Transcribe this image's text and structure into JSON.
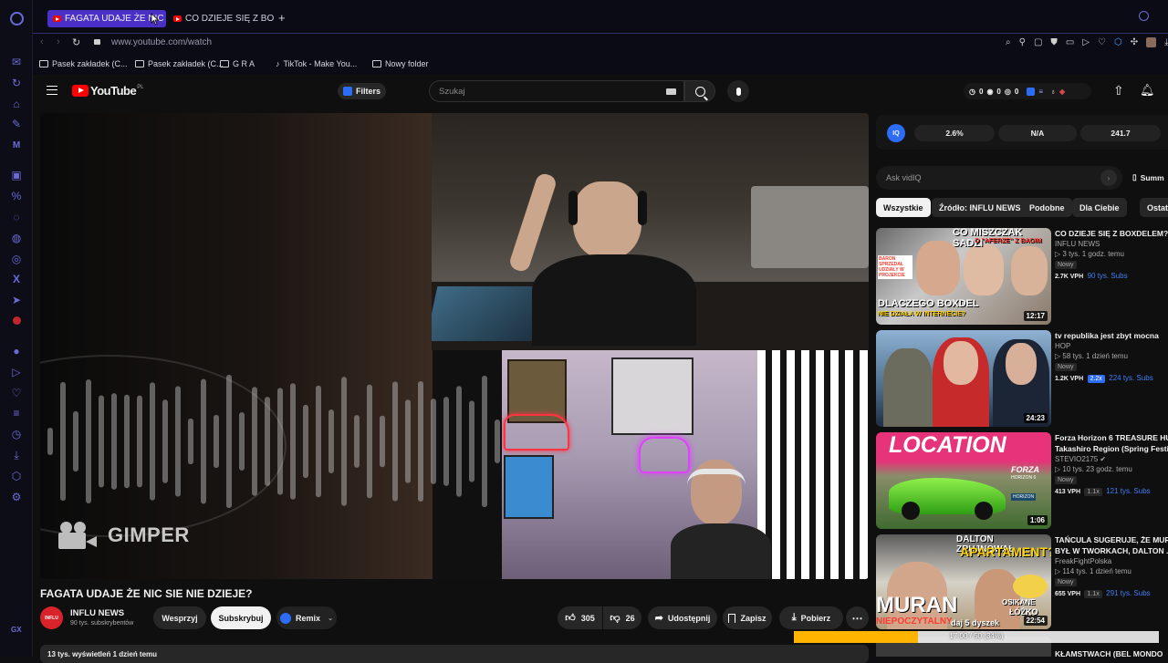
{
  "tabs": [
    {
      "label": "FAGATA UDAJE ŻE NIC"
    },
    {
      "label": "CO DZIEJE SIĘ Z BOXDELE"
    }
  ],
  "address": {
    "url": "www.youtube.com/watch"
  },
  "bookmarks": [
    "Pasek zakładek (C...",
    "Pasek zakładek (C...",
    "G R A",
    "TikTok - Make You...",
    "Nowy folder"
  ],
  "header": {
    "logo_text": "YouTube",
    "logo_region": "PL",
    "filters_label": "Filters",
    "search_placeholder": "Szukaj",
    "stats": [
      "0",
      "0",
      "0"
    ]
  },
  "player": {
    "watermark": "GIMPER"
  },
  "video": {
    "title": "FAGATA UDAJE ŻE NIC SIE NIE DZIEJE?",
    "channel": "INFLU NEWS",
    "subscribers": "90 tys. subskrybentów",
    "avatar_text": "INFLU",
    "support_label": "Wesprzyj",
    "subscribe_label": "Subskrybuj",
    "remix_label": "Remix",
    "likes": "305",
    "dislikes": "26",
    "share_label": "Udostępnij",
    "save_label": "Zapisz",
    "download_label": "Pobierz",
    "views_line": "13 tys. wyświetleń  1 dzień temu"
  },
  "vidiq": {
    "badge": "IQ",
    "stats": [
      "2.6%",
      "N/A",
      "241.7"
    ],
    "ask_placeholder": "Ask vidIQ",
    "summary_label": "Summ"
  },
  "chips": [
    "Wszystkie",
    "Źródło: INFLU NEWS",
    "Podobne",
    "Dla Ciebie",
    "Ostatnie"
  ],
  "recommendations": [
    {
      "title": "CO DZIEJE SIĘ Z BOXDELEM?",
      "title2": "",
      "channel": "INFLU NEWS",
      "meta": "3 tys.  1 godz. temu",
      "badge": "Nowy",
      "vph": "2.7K VPH",
      "ratio": "",
      "subs": "90 tys. Subs",
      "duration": "12:17",
      "thumb_top": "CO MISZCZAK SADZI",
      "thumb_top2": "O \"AFERZE\" Z BAGIM",
      "thumb_mid": "DLACZEGO BOXDEL",
      "thumb_bottom": "NIE DZIAŁA W INTERNECIE?",
      "thumb_side": "BARON SPRZEDAŁ UDZIAŁY W PROJEKCIE"
    },
    {
      "title": "tv republika jest zbyt mocna",
      "title2": "",
      "channel": "HOP",
      "meta": "58 tys.  1 dzień temu",
      "badge": "Nowy",
      "vph": "1.2K VPH",
      "ratio": "2.2x",
      "subs": "224 tys. Subs",
      "duration": "24:23"
    },
    {
      "title": "Forza Horizon 6 TREASURE HUN",
      "title2": "Takashiro Region (Spring Festiv",
      "channel": "STEVIO2175",
      "meta": "10 tys.  23 godz. temu",
      "badge": "Nowy",
      "vph": "413 VPH",
      "ratio": "1.1x",
      "subs": "121 tys. Subs",
      "duration": "1:06",
      "thumb_top": "LOCATION",
      "thumb_logo": "FORZA",
      "thumb_logo2": "HORIZON 6",
      "thumb_sign": "HORIZON"
    },
    {
      "title": "TAŃCULA SUGERUJE, ŻE MURA",
      "title2": "BYŁ W TWORKACH, DALTON ...",
      "channel": "FreakFightPolska",
      "meta": "114 tys.  1 dzień temu",
      "badge": "Nowy",
      "vph": "655 VPH",
      "ratio": "1.1x",
      "subs": "291 tys. Subs",
      "duration": "22:54",
      "thumb_top": "DALTON ZRUJNOWAŁ",
      "thumb_top2": "APARTAMENT?",
      "thumb_mid": "MURAN",
      "thumb_bottom": "NIEPOCZYTALNY",
      "thumb_side": "OSIKANE",
      "thumb_side2": "ŁÓŻKO"
    },
    {
      "title": "KŁAMSTWACH (BEL MONDO",
      "title2": ""
    }
  ],
  "overlay": {
    "label": "daj 5 dyszek",
    "progress_text": "17.00 / 50 (34%)",
    "progress": 0.34
  },
  "opera": {
    "badge": "GX"
  },
  "colors": {
    "accent": "#4b30c8",
    "yt_red": "#ff0000",
    "progress": "#ffb400",
    "vidiq_blue": "#2d6df6"
  }
}
